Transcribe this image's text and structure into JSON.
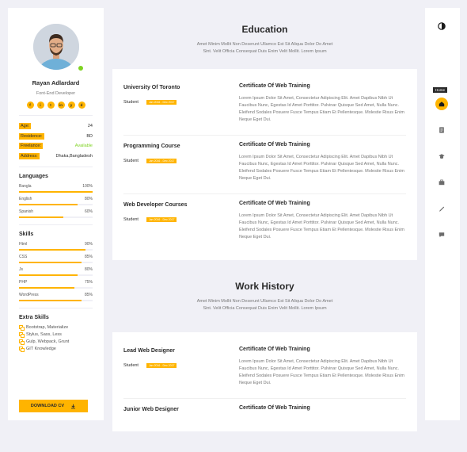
{
  "profile": {
    "name": "Rayan Adlardard",
    "role": "Font-End Developer",
    "socials": [
      "f",
      "i",
      "t",
      "in",
      "y",
      "d"
    ]
  },
  "info": [
    {
      "key": "Age:",
      "value": "24"
    },
    {
      "key": "Residence:",
      "value": "BD"
    },
    {
      "key": "Freelance:",
      "value": "Available"
    },
    {
      "key": "Address:",
      "value": "Dhaka,Bangladesh"
    }
  ],
  "languages": {
    "title": "Languages",
    "items": [
      {
        "label": "Bangla",
        "value": "100%",
        "level": 100
      },
      {
        "label": "English",
        "value": "80%",
        "level": 80
      },
      {
        "label": "Spanish",
        "value": "60%",
        "level": 60
      }
    ]
  },
  "skills": {
    "title": "Skills",
    "items": [
      {
        "label": "Html",
        "value": "90%",
        "level": 90
      },
      {
        "label": "CSS",
        "value": "85%",
        "level": 85
      },
      {
        "label": "Js",
        "value": "80%",
        "level": 80
      },
      {
        "label": "PHP",
        "value": "75%",
        "level": 75
      },
      {
        "label": "WordPress",
        "value": "85%",
        "level": 85
      }
    ]
  },
  "extra_skills": {
    "title": "Extra Skills",
    "items": [
      "Bootstrap, Materialize",
      "Stylus, Sass, Less",
      "Gulp, Webpack, Grunt",
      "GIT Knowledge"
    ]
  },
  "download_label": "DOWNLOAD CV",
  "education": {
    "title": "Education",
    "lead": "Amet Minim Mollit Non Deserunt Ullamco Est Sit Aliqua Dolor Do Amet Sint. Velit Officia Consequat Duis Enim Velit Mollit. Lorem Ipsum",
    "entries": [
      {
        "place": "University Of Toronto",
        "who": "Student",
        "date": "Jan 2016 - Dec 2017",
        "cert": "Certificate Of Web Training",
        "desc": "Lorem Ipsum Dolor Sit Amet, Consectetur Adipiscing Elit. Amet Dapibus Nibh Ut Faucibus Nunc, Egestas Id Amet Porttitor. Pulvinar Quisque Sed Amet, Nulla Nunc. Eleifend Sodales Posuere Fusce Tempus Etiam Et Pellentesque. Molestie Risus Enim Neque Eget Dui."
      },
      {
        "place": "Programming Course",
        "who": "Student",
        "date": "Jan 2016 - Dec 2017",
        "cert": "Certificate Of Web Training",
        "desc": "Lorem Ipsum Dolor Sit Amet, Consectetur Adipiscing Elit. Amet Dapibus Nibh Ut Faucibus Nunc, Egestas Id Amet Porttitor. Pulvinar Quisque Sed Amet, Nulla Nunc. Eleifend Sodales Posuere Fusce Tempus Etiam Et Pellentesque. Molestie Risus Enim Neque Eget Dui."
      },
      {
        "place": "Web Developer Courses",
        "who": "Student",
        "date": "Jan 2016 - Dec 2017",
        "cert": "Certificate Of Web Training",
        "desc": "Lorem Ipsum Dolor Sit Amet, Consectetur Adipiscing Elit. Amet Dapibus Nibh Ut Faucibus Nunc, Egestas Id Amet Porttitor. Pulvinar Quisque Sed Amet, Nulla Nunc. Eleifend Sodales Posuere Fusce Tempus Etiam Et Pellentesque. Molestie Risus Enim Neque Eget Dui."
      }
    ]
  },
  "work": {
    "title": "Work History",
    "lead": "Amet Minim Mollit Non Deserunt Ullamco Est Sit Aliqua Dolor Do Amet Sint. Velit Officia Consequat Duis Enim Velit Mollit. Lorem Ipsum",
    "entries": [
      {
        "place": "Lead Web Designer",
        "who": "Student",
        "date": "Jan 2016 - Dec 2017",
        "cert": "Certificate Of Web Training",
        "desc": "Lorem Ipsum Dolor Sit Amet, Consectetur Adipiscing Elit. Amet Dapibus Nibh Ut Faucibus Nunc, Egestas Id Amet Porttitor. Pulvinar Quisque Sed Amet, Nulla Nunc. Eleifend Sodales Posuere Fusce Tempus Etiam Et Pellentesque. Molestie Risus Enim Neque Eget Dui."
      },
      {
        "place": "Junior Web Designer",
        "who": "",
        "date": "",
        "cert": "Certificate Of Web Training",
        "desc": ""
      }
    ]
  },
  "nav": {
    "tooltip": "Home",
    "icons": [
      "theme-toggle-icon",
      "home-icon",
      "resume-icon",
      "education-icon",
      "portfolio-icon",
      "blog-icon",
      "chat-icon"
    ]
  },
  "colors": {
    "accent": "#ffb400",
    "available": "#7ed321",
    "background": "#f0f0f6"
  }
}
